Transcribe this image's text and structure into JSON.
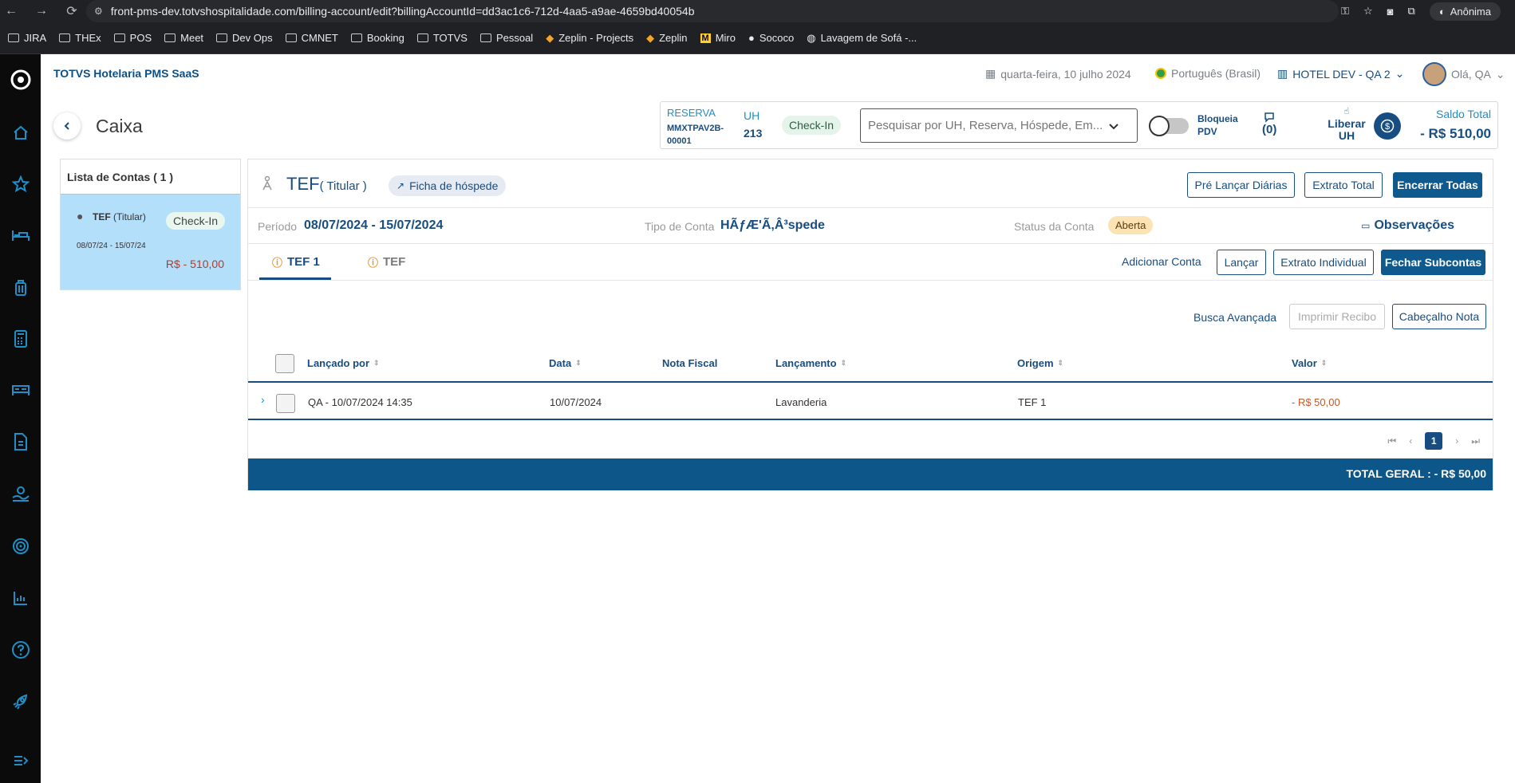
{
  "browser": {
    "url": "front-pms-dev.totvshospitalidade.com/billing-account/edit?billingAccountId=dd3ac1c6-712d-4aa5-a9ae-4659bd40054b",
    "profile": "Anônima",
    "bookmarks": [
      "JIRA",
      "THEx",
      "POS",
      "Meet",
      "Dev Ops",
      "CMNET",
      "Booking",
      "TOTVS",
      "Pessoal",
      "Zeplin - Projects",
      "Zeplin",
      "Miro",
      "Sococo",
      "Lavagem de Sofá -..."
    ]
  },
  "header": {
    "brand": "TOTVS Hotelaria PMS SaaS",
    "date": "quarta-feira, 10 julho 2024",
    "language": "Português (Brasil)",
    "hotel": "HOTEL DEV - QA 2",
    "user": "Olá, QA"
  },
  "page": {
    "title": "Caixa"
  },
  "reservation": {
    "label": "RESERVA",
    "code": "MMXTPAV2B-00001",
    "uh_label": "UH",
    "uh_number": "213",
    "status": "Check-In",
    "search_placeholder": "Pesquisar por UH, Reserva, Hóspede, Em...",
    "toggle_label": "Bloqueia PDV",
    "comments_count": "(0)",
    "liberar": "Liberar UH",
    "saldo_label": "Saldo Total",
    "saldo_value": "- R$ 510,00"
  },
  "accounts": {
    "title": "Lista de Contas ( 1 )",
    "items": [
      {
        "name": "TEF",
        "role": "(Titular)",
        "status": "Check-In",
        "dates": "08/07/24 - 15/07/24",
        "amount": "R$ - 510,00"
      }
    ]
  },
  "account": {
    "name": "TEF",
    "sub": "( Titular )",
    "ficha": "Ficha de hóspede",
    "btn_pre": "Pré Lançar Diárias",
    "btn_extrato_total": "Extrato Total",
    "btn_encerrar": "Encerrar Todas",
    "periodo_label": "Período",
    "periodo_value": "08/07/2024 - 15/07/2024",
    "tipo_label": "Tipo de Conta",
    "tipo_value": "HÃƒÆ'Ã‚Â³spede",
    "status_label": "Status da Conta",
    "status_value": "Aberta",
    "observacoes": "Observações"
  },
  "tabs": [
    {
      "label": "TEF 1",
      "active": true
    },
    {
      "label": "TEF",
      "active": false
    }
  ],
  "actions": {
    "adicionar": "Adicionar Conta",
    "lancar": "Lançar",
    "extrato_individual": "Extrato Individual",
    "fechar": "Fechar Subcontas",
    "busca": "Busca Avançada",
    "imprimir": "Imprimir Recibo",
    "cabecalho": "Cabeçalho Nota"
  },
  "table": {
    "columns": [
      "Lançado por",
      "Data",
      "Nota Fiscal",
      "Lançamento",
      "Origem",
      "Valor"
    ],
    "rows": [
      {
        "lancado_por": "QA - 10/07/2024 14:35",
        "data": "10/07/2024",
        "nota_fiscal": "",
        "lancamento": "Lavanderia",
        "origem": "TEF 1",
        "valor": "- R$ 50,00"
      }
    ]
  },
  "pagination": {
    "current": "1"
  },
  "total": "TOTAL GERAL : - R$ 50,00",
  "colors": {
    "primary": "#174d80",
    "accent": "#1e8fc7",
    "negative": "#b23b2c",
    "sidebar": "#0b0b0b"
  }
}
